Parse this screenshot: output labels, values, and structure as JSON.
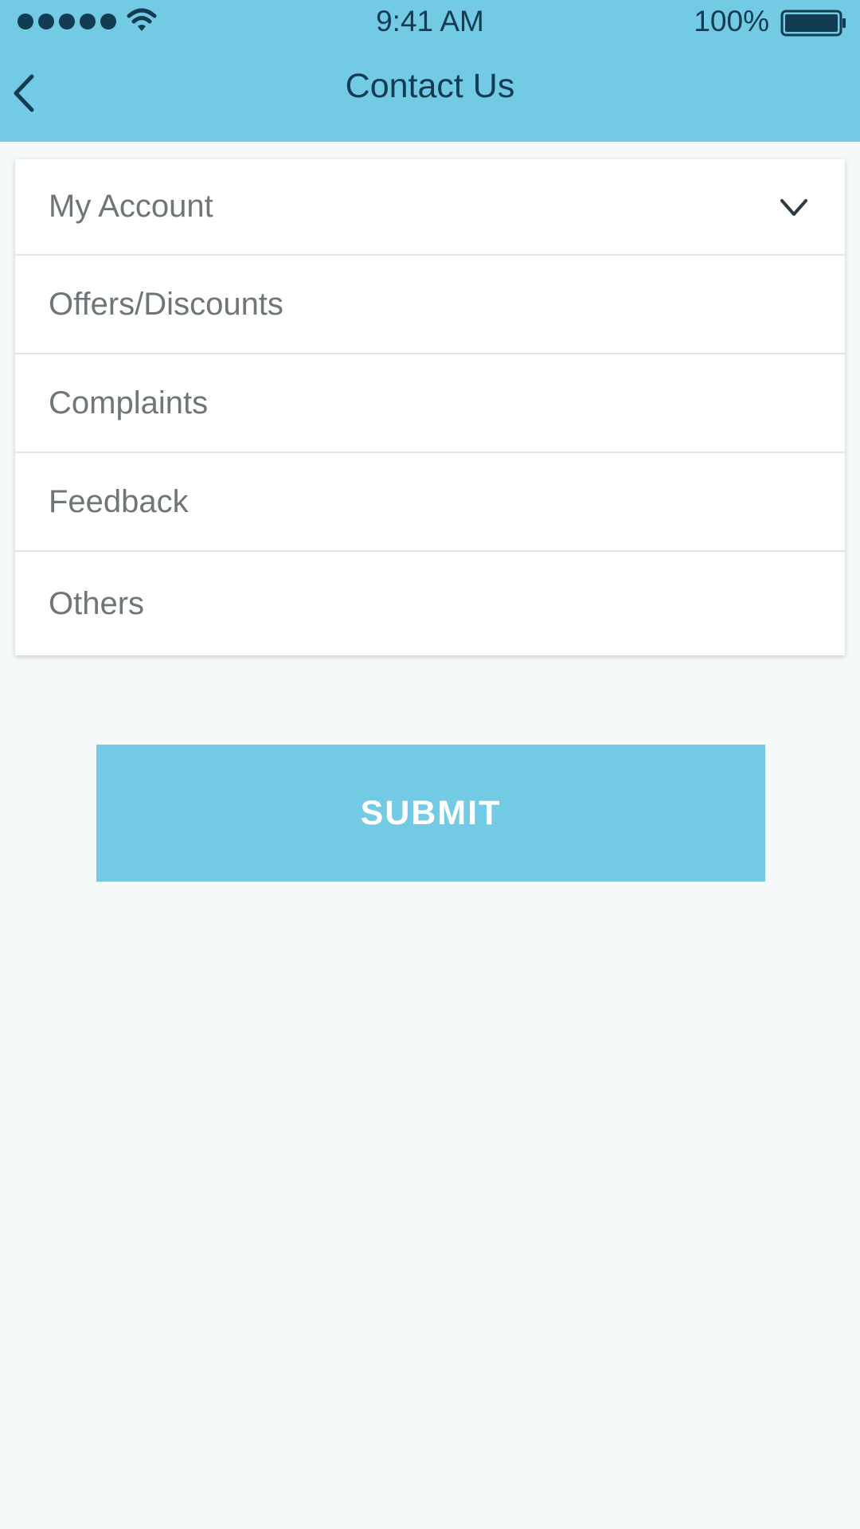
{
  "status_bar": {
    "time": "9:41 AM",
    "battery_percent": "100%",
    "signal_icon": "signal-dots-icon",
    "wifi_icon": "wifi-icon",
    "battery_icon": "battery-icon"
  },
  "header": {
    "title": "Contact Us",
    "back_icon": "chevron-left-icon"
  },
  "topics": {
    "selected": "My Account",
    "dropdown_icon": "chevron-down-icon",
    "options": [
      "Offers/Discounts",
      "Complaints",
      "Feedback",
      "Others"
    ]
  },
  "submit_label": "SUBMIT",
  "colors": {
    "accent": "#72cae5",
    "header_text": "#123c52",
    "item_text": "#6e7678",
    "background": "#f5f9fa"
  }
}
